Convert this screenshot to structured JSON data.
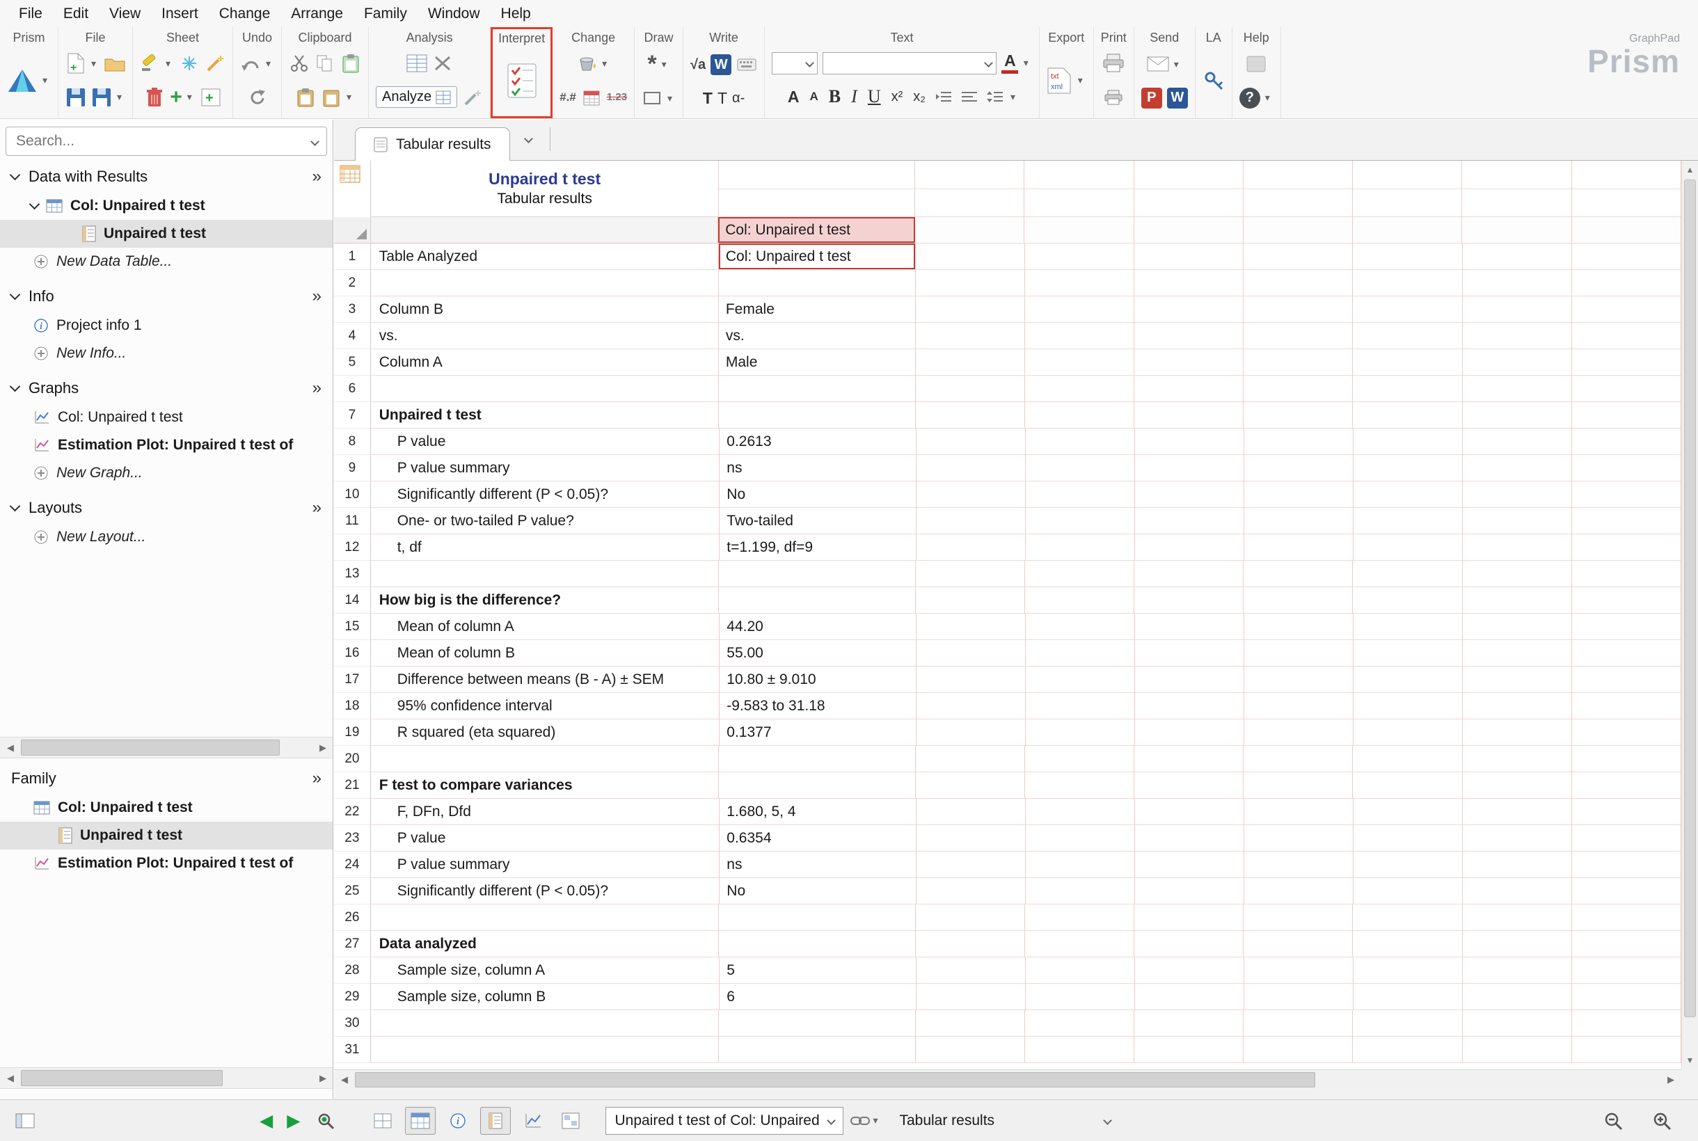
{
  "menubar": {
    "items": [
      "File",
      "Edit",
      "View",
      "Insert",
      "Change",
      "Arrange",
      "Family",
      "Window",
      "Help"
    ]
  },
  "toolbar": {
    "group_labels": {
      "prism": "Prism",
      "file": "File",
      "sheet": "Sheet",
      "undo": "Undo",
      "clipboard": "Clipboard",
      "analysis": "Analysis",
      "interpret": "Interpret",
      "change": "Change",
      "draw": "Draw",
      "write": "Write",
      "text": "Text",
      "export": "Export",
      "print": "Print",
      "send": "Send",
      "la": "LA",
      "help": "Help"
    },
    "analyze_button": "Analyze",
    "glyphs": {
      "number_format": "#.#",
      "decimal_format": "1.23",
      "sqrt_a": "√a",
      "write_w": "W",
      "text_t1": "T",
      "text_t2": "T",
      "alpha_dash": "α-",
      "font_color_a": "A",
      "grow_a": "A",
      "shrink_a": "A",
      "bold": "B",
      "italic": "I",
      "underline": "U",
      "superscript": "x²",
      "subscript": "x₂",
      "asterisk": "*",
      "export_txt": "txt",
      "export_xml": "xml",
      "ppt_p": "P",
      "word_w": "W",
      "help_q": "?"
    },
    "brand": {
      "top": "GraphPad",
      "name": "Prism"
    }
  },
  "sidebar": {
    "search_placeholder": "Search...",
    "expand_glyph": "»",
    "sections": {
      "data": {
        "title": "Data with Results",
        "table": "Col: Unpaired t test",
        "sheet": "Unpaired t test",
        "new_item": "New Data Table..."
      },
      "info": {
        "title": "Info",
        "item": "Project info 1",
        "new_item": "New Info..."
      },
      "graphs": {
        "title": "Graphs",
        "graph1": "Col: Unpaired t test",
        "graph2": "Estimation Plot: Unpaired t test of",
        "new_item": "New Graph..."
      },
      "layouts": {
        "title": "Layouts",
        "new_item": "New Layout..."
      },
      "family": {
        "title": "Family",
        "item1": "Col: Unpaired t test",
        "item2": "Unpaired t test",
        "item3": "Estimation Plot: Unpaired t test of"
      }
    }
  },
  "main": {
    "tab": "Tabular results",
    "sheet_title": {
      "line1": "Unpaired t test",
      "line2": "Tabular results"
    },
    "table": {
      "column_header": "Col: Unpaired t test",
      "rows": [
        {
          "n": 1,
          "label": "Table Analyzed",
          "value": "Col: Unpaired t test",
          "selected": true
        },
        {
          "n": 2
        },
        {
          "n": 3,
          "label": "Column B",
          "value": "Female"
        },
        {
          "n": 4,
          "label": "vs.",
          "value": "vs."
        },
        {
          "n": 5,
          "label": "Column A",
          "value": "Male"
        },
        {
          "n": 6
        },
        {
          "n": 7,
          "label": "Unpaired t test",
          "bold": true
        },
        {
          "n": 8,
          "label": "P value",
          "value": "0.2613",
          "indent": true
        },
        {
          "n": 9,
          "label": "P value summary",
          "value": "ns",
          "indent": true
        },
        {
          "n": 10,
          "label": "Significantly different (P < 0.05)?",
          "value": "No",
          "indent": true
        },
        {
          "n": 11,
          "label": "One- or two-tailed P value?",
          "value": "Two-tailed",
          "indent": true
        },
        {
          "n": 12,
          "label": "t, df",
          "value": "t=1.199, df=9",
          "indent": true
        },
        {
          "n": 13
        },
        {
          "n": 14,
          "label": "How big is the difference?",
          "bold": true
        },
        {
          "n": 15,
          "label": "Mean of column A",
          "value": "44.20",
          "indent": true
        },
        {
          "n": 16,
          "label": "Mean of column B",
          "value": "55.00",
          "indent": true
        },
        {
          "n": 17,
          "label": "Difference between means (B - A) ± SEM",
          "value": "10.80 ± 9.010",
          "indent": true
        },
        {
          "n": 18,
          "label": "95% confidence interval",
          "value": "-9.583 to 31.18",
          "indent": true
        },
        {
          "n": 19,
          "label": "R squared (eta squared)",
          "value": "0.1377",
          "indent": true
        },
        {
          "n": 20
        },
        {
          "n": 21,
          "label": "F test to compare variances",
          "bold": true
        },
        {
          "n": 22,
          "label": "F, DFn, Dfd",
          "value": "1.680, 5, 4",
          "indent": true
        },
        {
          "n": 23,
          "label": "P value",
          "value": "0.6354",
          "indent": true
        },
        {
          "n": 24,
          "label": "P value summary",
          "value": "ns",
          "indent": true
        },
        {
          "n": 25,
          "label": "Significantly different (P < 0.05)?",
          "value": "No",
          "indent": true
        },
        {
          "n": 26
        },
        {
          "n": 27,
          "label": "Data analyzed",
          "bold": true
        },
        {
          "n": 28,
          "label": "Sample size, column A",
          "value": "5",
          "indent": true
        },
        {
          "n": 29,
          "label": "Sample size, column B",
          "value": "6",
          "indent": true
        },
        {
          "n": 30
        },
        {
          "n": 31
        }
      ]
    }
  },
  "statusbar": {
    "sheet_selector": "Unpaired t test of Col: Unpaired",
    "view_selector": "Tabular results"
  },
  "colors": {
    "accent_red": "#c23b34",
    "grid_pink": "#eecaca",
    "header_pink": "#f5d2d2",
    "title_blue": "#2b3a92",
    "nav_green": "#18a03c",
    "selection_gray": "#e2e2e2"
  }
}
